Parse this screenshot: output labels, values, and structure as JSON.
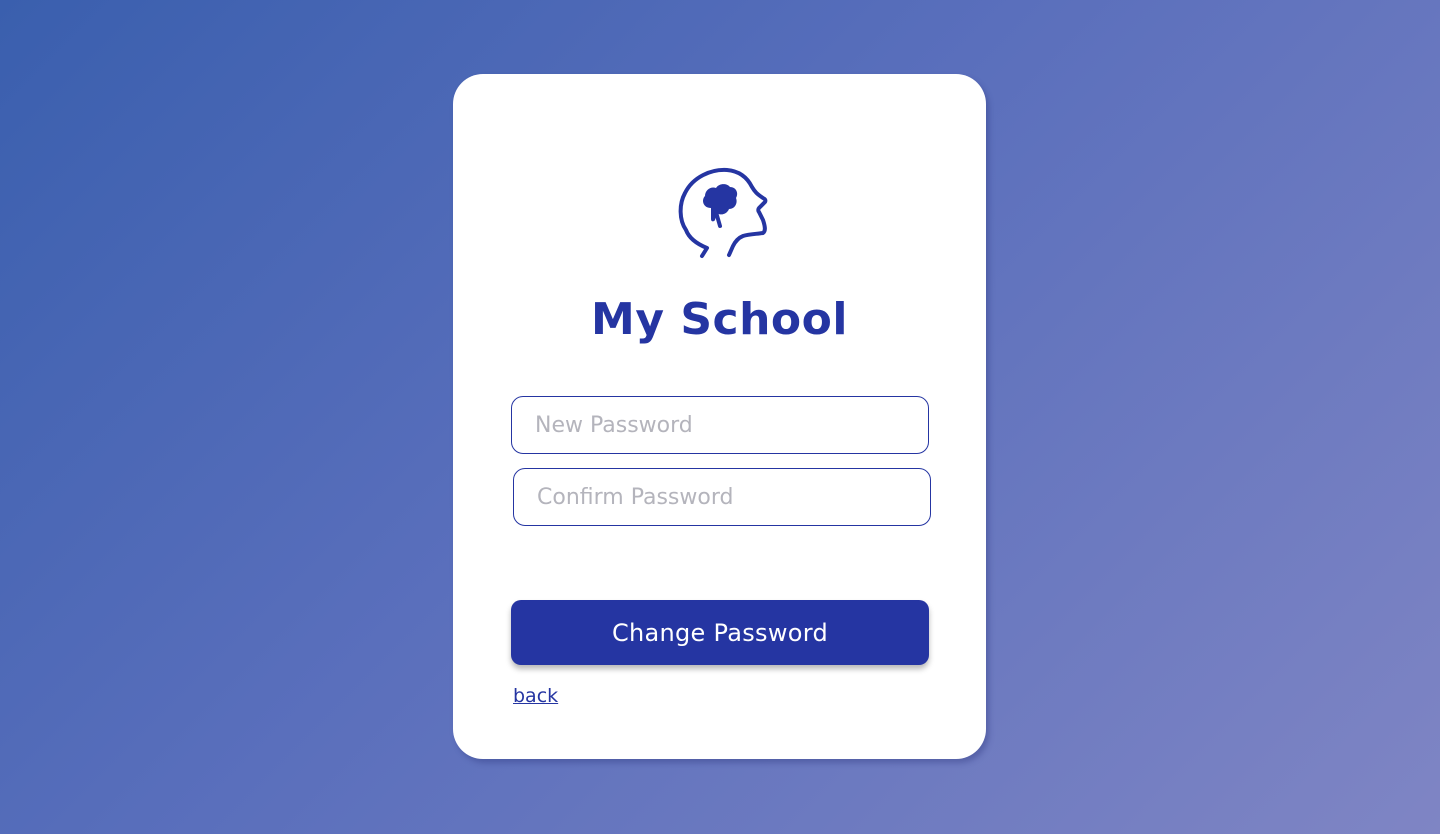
{
  "brand": {
    "title": "My School",
    "logo_icon": "head-brain-icon",
    "color": "#2535a2"
  },
  "form": {
    "new_password_placeholder": "New Password",
    "new_password_value": "",
    "confirm_password_placeholder": "Confirm Password",
    "confirm_password_value": "",
    "submit_label": "Change Password",
    "back_label": "back"
  },
  "colors": {
    "accent": "#2535a2",
    "card": "#ffffff",
    "placeholder": "#b4b4bc"
  }
}
